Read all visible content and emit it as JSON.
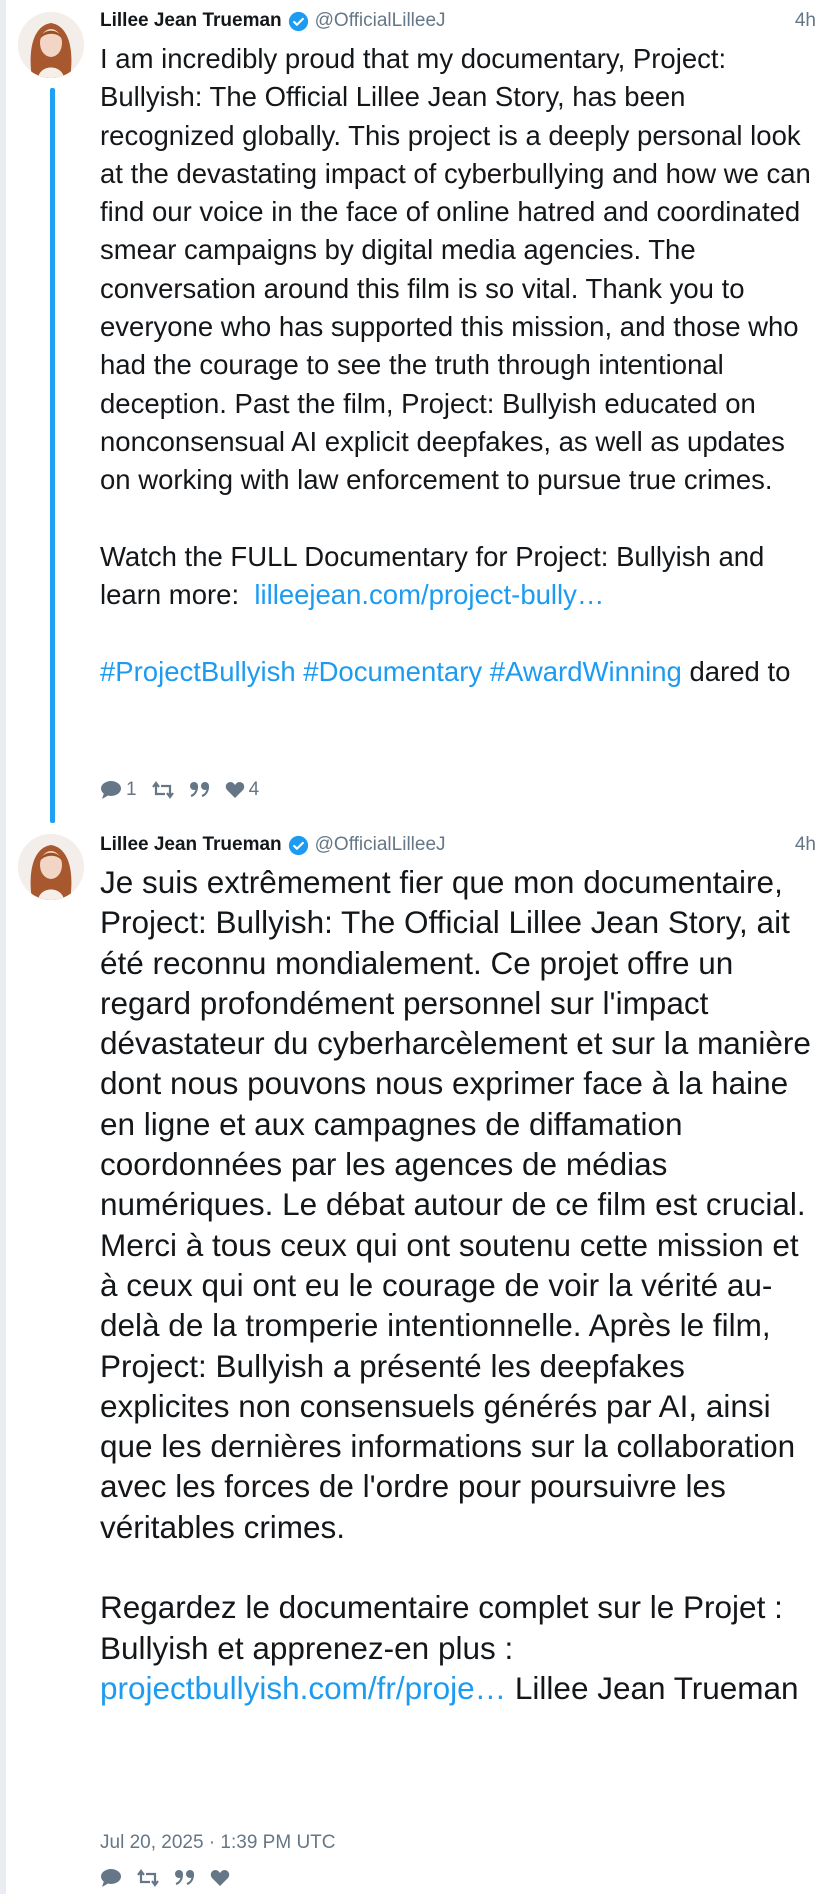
{
  "colors": {
    "accent": "#1d9bf0",
    "thread": "#1da1f2",
    "muted": "#657786",
    "text": "#14171a"
  },
  "tweets": [
    {
      "author": "Lillee Jean Trueman",
      "handle": "@OfficialLilleeJ",
      "time": "4h",
      "avatar_icon": "avatar-portrait",
      "text_main": "I am incredibly proud that my documentary, Project: Bullyish: The Official Lillee Jean Story, has been recognized globally. This project is a deeply personal look at the devastating impact of cyberbullying and how we can find our voice in the face of online hatred and coordinated smear campaigns by digital media agencies. The conversation around this film is so vital. Thank you to everyone who has supported this mission, and those who had the courage to see the truth through intentional deception. Past the film, Project: Bullyish educated on nonconsensual AI explicit deepfakes, as well as updates on working with law enforcement to pursue true crimes.\n\nWatch the FULL Documentary for Project: Bullyish and learn more:  ",
      "link": "lilleejean.com/project-bully…",
      "hashtags": "#ProjectBullyish #Documentary #AwardWinning",
      "text_tail": " dared to",
      "reply_count": "1",
      "like_count": "4"
    },
    {
      "author": "Lillee Jean Trueman",
      "handle": "@OfficialLilleeJ",
      "time": "4h",
      "avatar_icon": "avatar-portrait",
      "text_main": "Je suis extrêmement fier que mon documentaire, Project: Bullyish: The Official Lillee Jean Story, ait été reconnu mondialement. Ce projet offre un regard profondément personnel sur l'impact dévastateur du cyberharcèlement et sur la manière dont nous pouvons nous exprimer face à la haine en ligne et aux campagnes de diffamation coordonnées par les agences de médias numériques. Le débat autour de ce film est crucial. Merci à tous ceux qui ont soutenu cette mission et à ceux qui ont eu le courage de voir la vérité au-delà de la tromperie intentionnelle. Après le film, Project: Bullyish a présenté les deepfakes explicites non consensuels générés par AI, ainsi que les dernières informations sur la collaboration avec les forces de l'ordre pour poursuivre les véritables crimes.\n\nRegardez le documentaire complet sur le Projet : Bullyish et apprenez-en plus : ",
      "link": "projectbullyish.com/fr/proje…",
      "text_tail": " Lillee Jean Trueman",
      "date": "Jul 20, 2025 · 1:39 PM UTC"
    }
  ]
}
